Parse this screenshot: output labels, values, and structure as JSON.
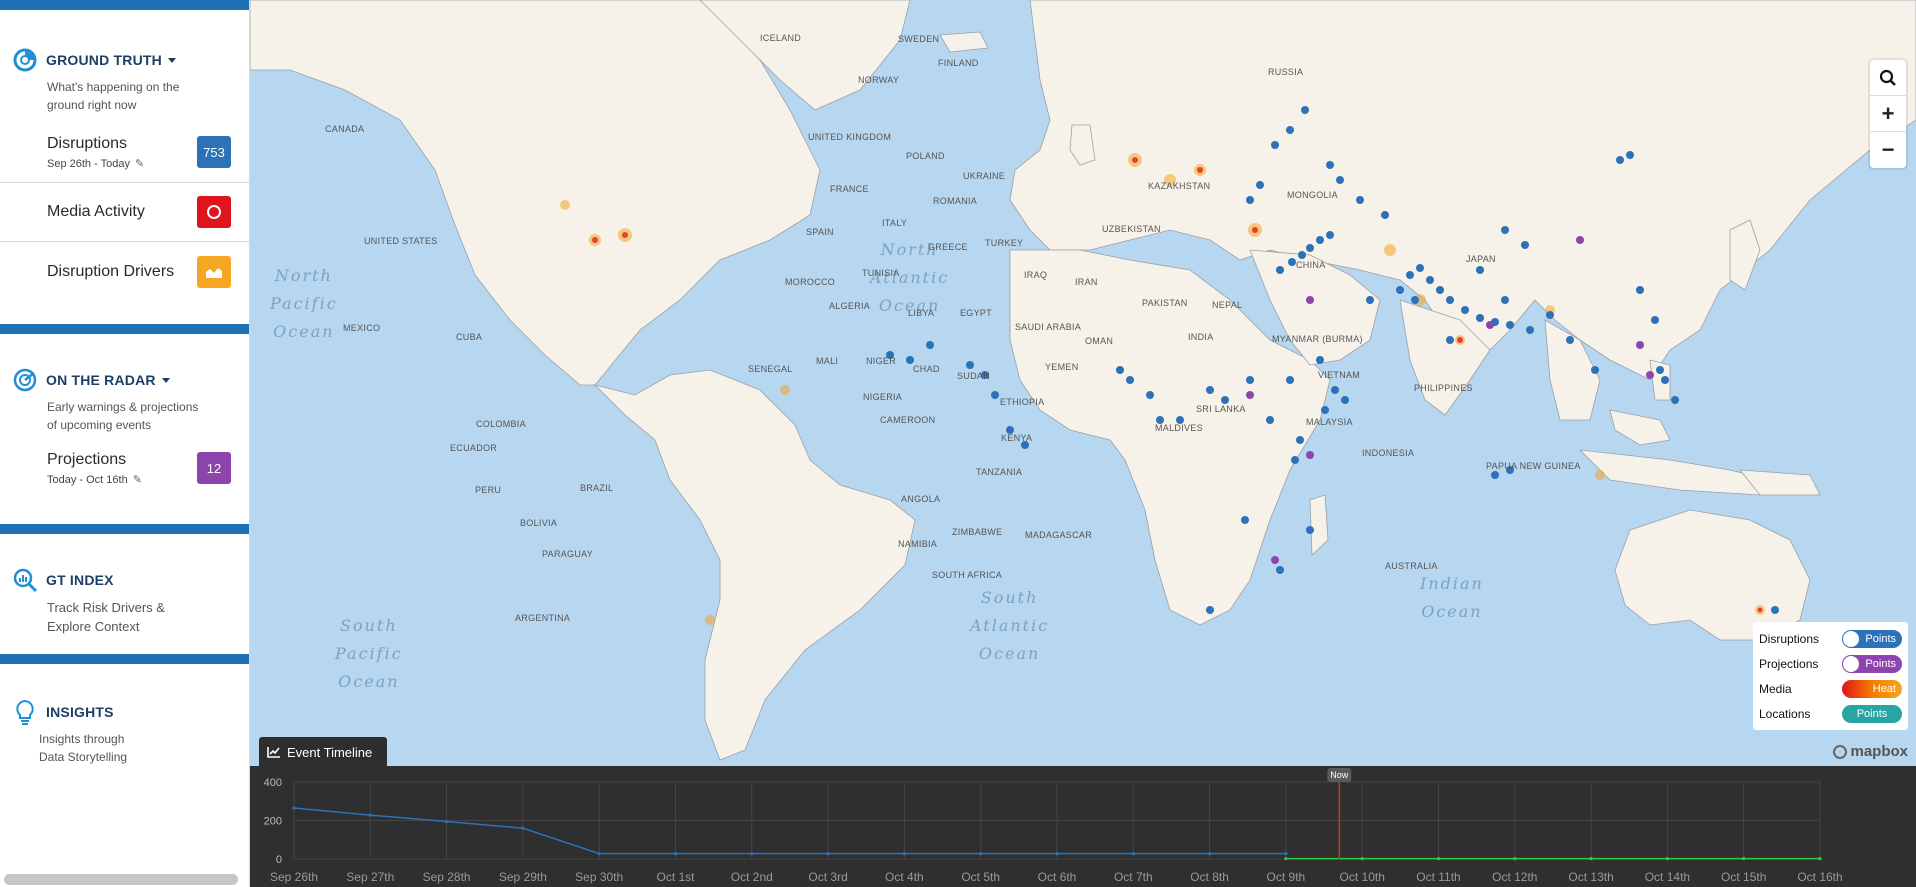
{
  "sidebar": {
    "ground_truth": {
      "title": "GROUND TRUTH",
      "subtitle_line1": "What's happening on the",
      "subtitle_line2": "ground right now",
      "disruptions": {
        "label": "Disruptions",
        "date_range": "Sep 26th - Today",
        "count": "753",
        "badge_color": "#2b72b8"
      },
      "media_activity": {
        "label": "Media Activity",
        "badge_color": "#e0141c"
      },
      "disruption_drivers": {
        "label": "Disruption Drivers",
        "badge_color": "#f5a623"
      }
    },
    "on_the_radar": {
      "title": "ON THE RADAR",
      "subtitle_line1": "Early warnings & projections",
      "subtitle_line2": "of upcoming events",
      "projections": {
        "label": "Projections",
        "date_range": "Today - Oct 16th",
        "count": "12",
        "badge_color": "#8e44ad"
      }
    },
    "gt_index": {
      "title": "GT INDEX",
      "subtitle_line1": "Track Risk Drivers &",
      "subtitle_line2": "Explore Context"
    },
    "insights": {
      "title": "INSIGHTS",
      "subtitle_line1": "Insights through",
      "subtitle_line2": "Data Storytelling"
    }
  },
  "map": {
    "oceans": {
      "north_pacific": [
        "North",
        "Pacific",
        "Ocean"
      ],
      "north_atlantic": [
        "North",
        "Atlantic",
        "Ocean"
      ],
      "south_pacific": [
        "South",
        "Pacific",
        "Ocean"
      ],
      "south_atlantic": [
        "South",
        "Atlantic",
        "Ocean"
      ],
      "indian": [
        "Indian",
        "Ocean"
      ]
    },
    "countries": [
      "ICELAND",
      "SWEDEN",
      "FINLAND",
      "NORWAY",
      "RUSSIA",
      "CANADA",
      "UNITED KINGDOM",
      "POLAND",
      "UKRAINE",
      "FRANCE",
      "ROMANIA",
      "ITALY",
      "KAZAKHSTAN",
      "MONGOLIA",
      "UNITED STATES",
      "SPAIN",
      "GREECE",
      "TURKEY",
      "UZBEKISTAN",
      "CHINA",
      "JAPAN",
      "MOROCCO",
      "TUNISIA",
      "IRAQ",
      "IRAN",
      "ALGERIA",
      "LIBYA",
      "EGYPT",
      "SAUDI ARABIA",
      "PAKISTAN",
      "NEPAL",
      "INDIA",
      "OMAN",
      "YEMEN",
      "MEXICO",
      "CUBA",
      "MALI",
      "NIGER",
      "CHAD",
      "SUDAN",
      "MYANMAR (BURMA)",
      "VIETNAM",
      "PHILIPPINES",
      "SENEGAL",
      "NIGERIA",
      "ETHIOPIA",
      "COLOMBIA",
      "CAMEROON",
      "SRI LANKA",
      "MALAYSIA",
      "ECUADOR",
      "KENYA",
      "MALDIVES",
      "INDONESIA",
      "TANZANIA",
      "PAPUA NEW GUINEA",
      "PERU",
      "BRAZIL",
      "ANGOLA",
      "BOLIVIA",
      "ZIMBABWE",
      "MADAGASCAR",
      "NAMIBIA",
      "PARAGUAY",
      "AUSTRALIA",
      "SOUTH AFRICA",
      "ARGENTINA"
    ],
    "controls": {
      "search_icon": "search-icon",
      "zoom_in": "+",
      "zoom_out": "−"
    },
    "legend": {
      "disruptions": {
        "label": "Disruptions",
        "toggle": "Points",
        "color": "#2b72b8"
      },
      "projections": {
        "label": "Projections",
        "toggle": "Points",
        "color": "#8e44ad"
      },
      "media": {
        "label": "Media",
        "toggle": "Heat"
      },
      "locations": {
        "label": "Locations",
        "toggle": "Points",
        "color": "#2aa3a3"
      }
    },
    "attribution": "mapbox",
    "point_colors": {
      "disruption": "#2b72b8",
      "projection": "#8e44ad"
    }
  },
  "timeline": {
    "tab_label": "Event Timeline",
    "now_label": "Now",
    "y_ticks": [
      "400",
      "200",
      "0"
    ],
    "dates": [
      "Sep 26th",
      "Sep 27th",
      "Sep 28th",
      "Sep 29th",
      "Sep 30th",
      "Oct 1st",
      "Oct 2nd",
      "Oct 3rd",
      "Oct 4th",
      "Oct 5th",
      "Oct 6th",
      "Oct 7th",
      "Oct 8th",
      "Oct 9th",
      "Oct 10th",
      "Oct 11th",
      "Oct 12th",
      "Oct 13th",
      "Oct 14th",
      "Oct 15th",
      "Oct 16th"
    ],
    "series": {
      "disruptions": {
        "color": "#2b72b8",
        "values": [
          265,
          228,
          195,
          160,
          28,
          28,
          28,
          28,
          28,
          28,
          28,
          28,
          28,
          28
        ]
      },
      "projections": {
        "color": "#2ecc40",
        "values": [
          2,
          2,
          2,
          2,
          2,
          2,
          2,
          2
        ]
      }
    },
    "now_index": 13.7
  }
}
